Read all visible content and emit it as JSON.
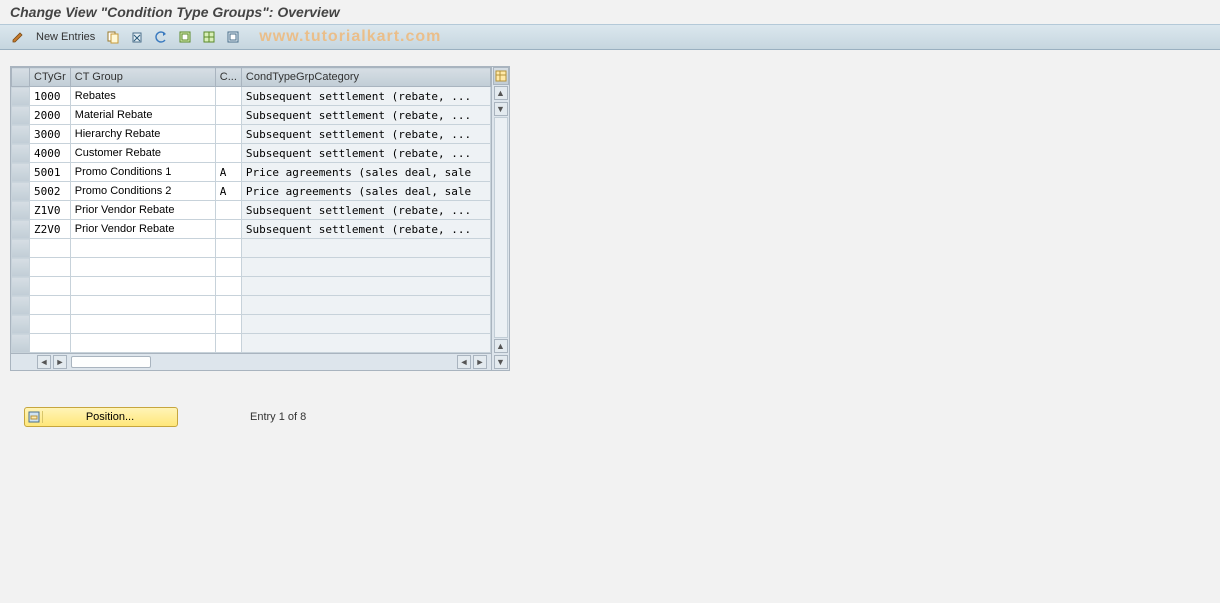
{
  "title": "Change View \"Condition Type Groups\": Overview",
  "toolbar": {
    "new_entries": "New Entries"
  },
  "watermark": "www.tutorialkart.com",
  "columns": {
    "ctygr": "CTyGr",
    "ctgroup": "CT Group",
    "c": "C...",
    "category": "CondTypeGrpCategory"
  },
  "rows": [
    {
      "ctygr": "1000",
      "ctgroup": "Rebates",
      "c": "",
      "category": "Subsequent settlement (rebate, ..."
    },
    {
      "ctygr": "2000",
      "ctgroup": "Material Rebate",
      "c": "",
      "category": "Subsequent settlement (rebate, ..."
    },
    {
      "ctygr": "3000",
      "ctgroup": "Hierarchy Rebate",
      "c": "",
      "category": "Subsequent settlement (rebate, ..."
    },
    {
      "ctygr": "4000",
      "ctgroup": "Customer Rebate",
      "c": "",
      "category": "Subsequent settlement (rebate, ..."
    },
    {
      "ctygr": "5001",
      "ctgroup": "Promo Conditions 1",
      "c": "A",
      "category": "Price agreements (sales deal, sale"
    },
    {
      "ctygr": "5002",
      "ctgroup": "Promo Conditions 2",
      "c": "A",
      "category": "Price agreements (sales deal, sale"
    },
    {
      "ctygr": "Z1V0",
      "ctgroup": "Prior Vendor Rebate",
      "c": "",
      "category": "Subsequent settlement (rebate, ..."
    },
    {
      "ctygr": "Z2V0",
      "ctgroup": "Prior Vendor Rebate",
      "c": "",
      "category": "Subsequent settlement (rebate, ..."
    }
  ],
  "empty_rows": 6,
  "footer": {
    "position_label": "Position...",
    "entry_text": "Entry 1 of 8"
  }
}
